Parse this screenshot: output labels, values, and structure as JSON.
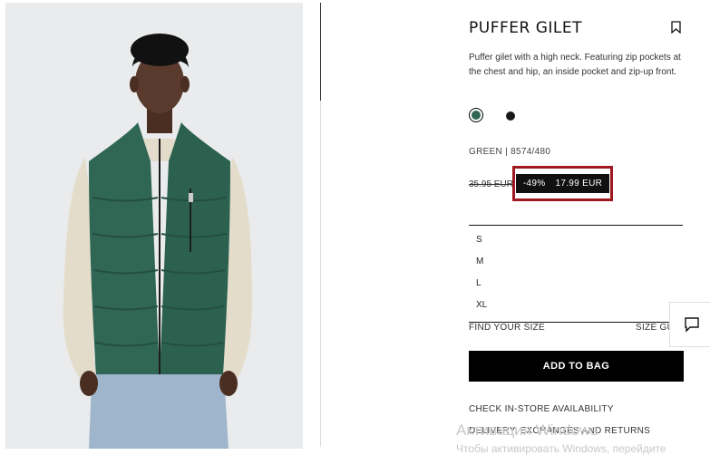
{
  "product": {
    "title": "PUFFER GILET",
    "description": "Puffer gilet with a high neck. Featuring zip pockets at the chest and hip, an inside pocket and zip-up front.",
    "color_ref": "GREEN | 8574/480",
    "old_price": "35.95 EUR",
    "discount": "-49%",
    "sale_price": "17.99 EUR",
    "swatches": [
      {
        "name": "green",
        "color": "#2f6654",
        "selected": true
      },
      {
        "name": "black",
        "color": "#1a1a1a",
        "selected": false
      }
    ]
  },
  "sizes": [
    "S",
    "M",
    "L",
    "XL"
  ],
  "find_size": "FIND YOUR SIZE",
  "size_guide": "SIZE GUIDE",
  "add_to_bag": "ADD TO BAG",
  "links": {
    "store": "CHECK IN-STORE AVAILABILITY",
    "delivery": "DELIVERY, EXCHANGES AND RETURNS"
  },
  "watermark": {
    "line1": "Активация Windows",
    "line2": "Чтобы активировать Windows, перейдите"
  },
  "colors": {
    "highlight_border": "#a01820",
    "button_bg": "#000000"
  }
}
